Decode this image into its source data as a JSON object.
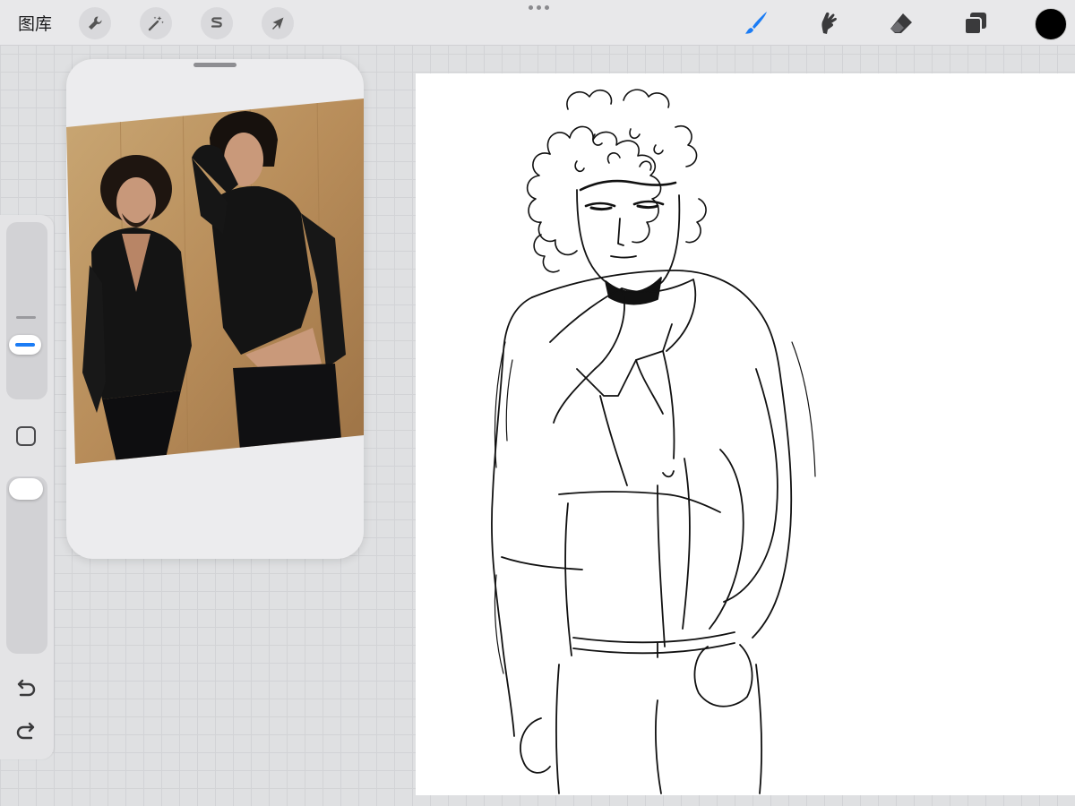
{
  "toolbar": {
    "gallery_label": "图库",
    "left_tools": [
      {
        "name": "actions",
        "icon": "wrench-icon"
      },
      {
        "name": "adjustments",
        "icon": "magic-wand-icon"
      },
      {
        "name": "selection",
        "icon": "selection-s-icon"
      },
      {
        "name": "transform",
        "icon": "arrow-cursor-icon"
      }
    ],
    "right_tools": [
      {
        "name": "brush",
        "icon": "brush-icon",
        "active": true
      },
      {
        "name": "smudge",
        "icon": "smudge-icon",
        "active": false
      },
      {
        "name": "eraser",
        "icon": "eraser-icon",
        "active": false
      },
      {
        "name": "layers",
        "icon": "layers-icon",
        "active": false
      }
    ],
    "current_color": "#000000",
    "accent_color": "#1b7cf5"
  },
  "sidebar": {
    "brush_size_icon": "slider-thumb",
    "modify_icon": "square-icon",
    "undo_icon": "undo-icon",
    "redo_icon": "redo-icon"
  },
  "reference_window": {
    "image": "reference-photo-two-men-leather-jackets"
  },
  "canvas": {
    "content": "line-sketch-curly-haired-man-leather-jacket"
  }
}
